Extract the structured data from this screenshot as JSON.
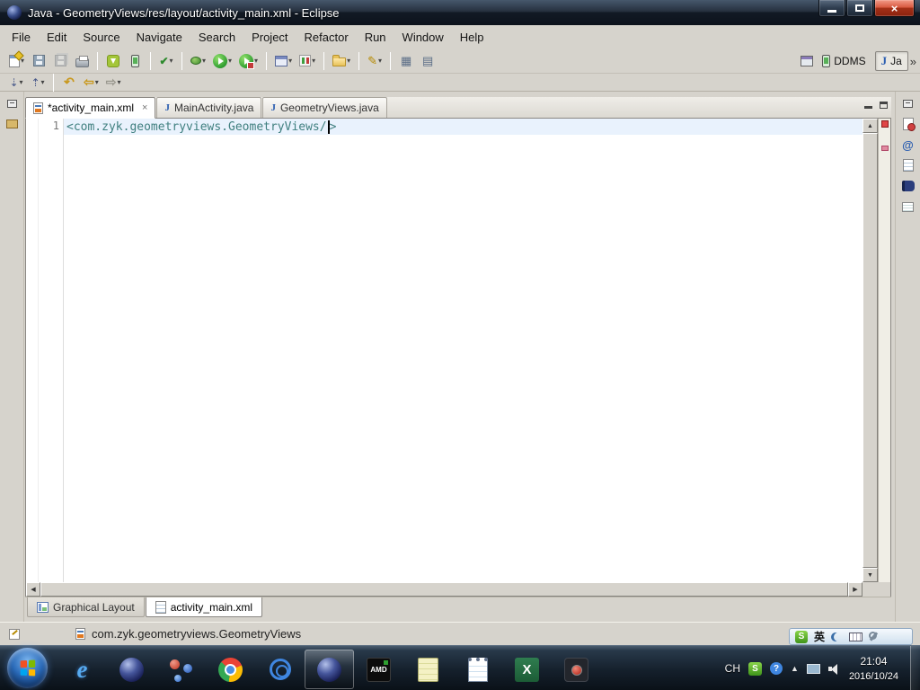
{
  "titlebar": {
    "title": "Java - GeometryViews/res/layout/activity_main.xml - Eclipse",
    "close_glyph": "×"
  },
  "menubar": {
    "items": [
      "File",
      "Edit",
      "Source",
      "Navigate",
      "Search",
      "Project",
      "Refactor",
      "Run",
      "Window",
      "Help"
    ]
  },
  "glyphs": {
    "dropdown": "▾",
    "up": "▲",
    "down": "▼",
    "left": "◀",
    "right": "▶",
    "check": "✔",
    "pencil": "✎",
    "table": "▦",
    "table2": "▤",
    "back": "⇦",
    "forward": "⇨",
    "last_edit": "↶",
    "next_ann": "⇣",
    "prev_ann": "⇡",
    "at": "@",
    "close": "×",
    "java": "J",
    "overflow": "»"
  },
  "perspective": {
    "ddms": "DDMS",
    "java": "Ja"
  },
  "editor_tabs": [
    {
      "label": "*activity_main.xml"
    },
    {
      "label": "MainActivity.java"
    },
    {
      "label": "GeometryViews.java"
    }
  ],
  "editor": {
    "line_number": "1",
    "code_before_caret": "<com.zyk.geometryviews.GeometryViews/",
    "code_after_caret": ">"
  },
  "bottom_tabs": [
    {
      "label": "Graphical Layout"
    },
    {
      "label": "activity_main.xml"
    }
  ],
  "statusbar": {
    "text": "com.zyk.geometryviews.GeometryViews"
  },
  "ime": {
    "logo": "S",
    "lang": "英"
  },
  "taskbar": {
    "ie": "e",
    "amd": "AMD",
    "excel": "X",
    "tray_lang": "CH",
    "tray_sogou": "S",
    "tray_help": "?",
    "time": "21:04",
    "date": "2016/10/24"
  },
  "colors": {
    "code_teal": "#3f7f7f",
    "chrome_gray": "#d6d3cc",
    "titlebar_dark": "#121a25",
    "taskbar_dark": "#15202c",
    "close_red": "#a33017",
    "run_green": "#2f9e30",
    "android_green": "#a4c639",
    "marker_red": "#e04545"
  }
}
